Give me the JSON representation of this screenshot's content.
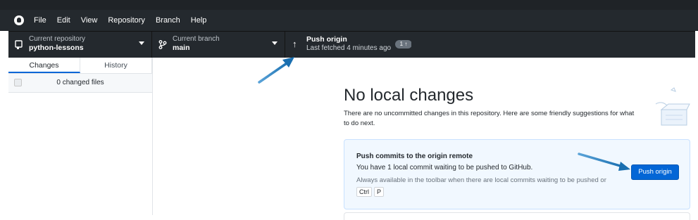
{
  "menu": {
    "items": [
      "File",
      "Edit",
      "View",
      "Repository",
      "Branch",
      "Help"
    ]
  },
  "toolbar": {
    "repo": {
      "label": "Current repository",
      "value": "python-lessons",
      "icon": "repo-icon"
    },
    "branch": {
      "label": "Current branch",
      "value": "main",
      "icon": "branch-icon"
    },
    "push": {
      "label": "Push origin",
      "sub": "Last fetched 4 minutes ago",
      "badge": "1 ↑",
      "icon": "arrow-up-icon"
    }
  },
  "sidebar": {
    "tabs": [
      {
        "label": "Changes",
        "active": true
      },
      {
        "label": "History",
        "active": false
      }
    ],
    "changed_files": "0 changed files"
  },
  "main": {
    "title": "No local changes",
    "description": "There are no uncommitted changes in this repository. Here are some friendly suggestions for what to do next.",
    "card": {
      "title": "Push commits to the origin remote",
      "desc": "You have 1 local commit waiting to be pushed to GitHub.",
      "hint": "Always available in the toolbar when there are local commits waiting to be pushed or",
      "shortcut_keys": [
        "Ctrl",
        "P"
      ],
      "button_label": "Push origin"
    }
  },
  "colors": {
    "accent": "#0366d6",
    "toolbar_bg": "#24292e",
    "annotation_arrow": "#1a73b8"
  }
}
